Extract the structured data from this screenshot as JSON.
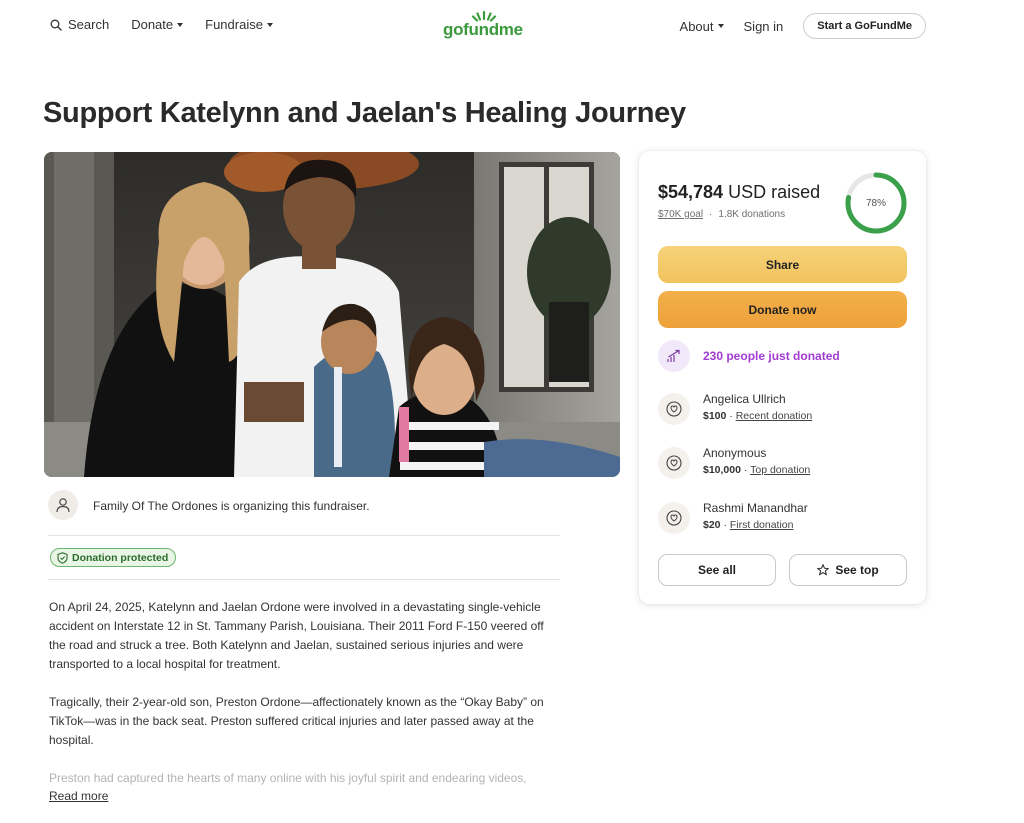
{
  "header": {
    "search_label": "Search",
    "donate_label": "Donate",
    "fundraise_label": "Fundraise",
    "logo_text": "gofundme",
    "about_label": "About",
    "signin_label": "Sign in",
    "start_label": "Start a GoFundMe"
  },
  "page_title": "Support Katelynn and Jaelan's Healing Journey",
  "organizer": {
    "text": "Family Of The Ordones is organizing this fundraiser."
  },
  "badge": {
    "label": "Donation protected"
  },
  "story": {
    "paragraphs": [
      "On April 24, 2025, Katelynn and Jaelan Ordone were involved in a devastating single-vehicle accident on Interstate 12 in St. Tammany Parish, Louisiana. Their 2011 Ford F-150 veered off the road and struck a tree. Both Katelynn and Jaelan, sustained serious injuries and were transported to a local hospital for treatment.",
      "Tragically, their 2-year-old son, Preston Ordone—affectionately known as the “Okay Baby” on TikTok—was in the back seat. Preston suffered critical injuries and later passed away at the hospital.",
      "Preston had captured the hearts of many online with his joyful spirit and endearing videos,"
    ],
    "read_more": "Read more"
  },
  "card": {
    "raised_amount": "$54,784",
    "raised_suffix": " USD raised",
    "goal": "$70K goal",
    "donations": "1.8K donations",
    "progress_percent": 78,
    "progress_label": "78%",
    "share_label": "Share",
    "donate_label": "Donate now",
    "trend_text": "230 people just donated",
    "donors": [
      {
        "name": "Angelica Ullrich",
        "amount": "$100",
        "tag": "Recent donation"
      },
      {
        "name": "Anonymous",
        "amount": "$10,000",
        "tag": "Top donation"
      },
      {
        "name": "Rashmi Manandhar",
        "amount": "$20",
        "tag": "First donation"
      }
    ],
    "see_all_label": "See all",
    "see_top_label": "See top"
  },
  "colors": {
    "brand_green": "#3a9a3c",
    "share_yellow": "#f1c35d",
    "donate_orange": "#eda13a",
    "trend_purple": "#a23bd1",
    "ring_green": "#3aa04a"
  }
}
